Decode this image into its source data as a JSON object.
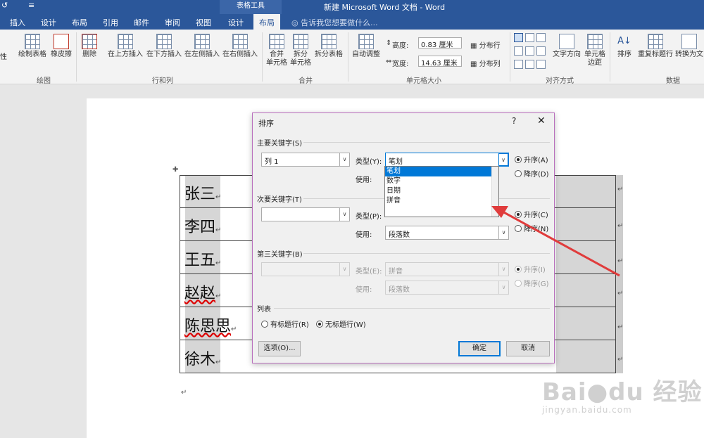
{
  "titlebar": {
    "quick_access": [
      "↺",
      "≡"
    ],
    "context_tab": "表格工具",
    "document_title": "新建 Microsoft Word 文档 - Word"
  },
  "tabs": {
    "insert": "插入",
    "design": "设计",
    "layout": "布局",
    "references": "引用",
    "mailings": "邮件",
    "review": "审阅",
    "view": "视图",
    "table_design": "设计",
    "table_layout": "布局",
    "tell_me": "告诉我您想要做什么..."
  },
  "ribbon": {
    "properties_partial": "性",
    "draw_table": "绘制表格",
    "eraser": "橡皮擦",
    "group_draw": "绘图",
    "delete": "删除",
    "insert_above": "在上方插入",
    "insert_below": "在下方插入",
    "insert_left": "在左侧插入",
    "insert_right": "在右侧插入",
    "group_rows_cols": "行和列",
    "merge_cells": "合并\n单元格",
    "merge_cells_l1": "合并",
    "merge_cells_l2": "单元格",
    "split_cells_l1": "拆分",
    "split_cells_l2": "单元格",
    "split_table": "拆分表格",
    "group_merge": "合并",
    "autofit": "自动调整",
    "height_label": "高度:",
    "height_value": "0.83 厘米",
    "width_label": "宽度:",
    "width_value": "14.63 厘米",
    "distribute_rows": "分布行",
    "distribute_cols": "分布列",
    "group_cell_size": "单元格大小",
    "text_direction": "文字方向",
    "cell_margins_l1": "单元格",
    "cell_margins_l2": "边距",
    "group_alignment": "对齐方式",
    "sort": "排序",
    "repeat_header": "重复标题行",
    "convert_text": "转换为文",
    "group_data": "数据"
  },
  "table_rows": [
    "张三",
    "李四",
    "王五",
    "赵赵",
    "陈思思",
    "徐木"
  ],
  "paragraph_mark": "↵",
  "dialog": {
    "title": "排序",
    "help": "?",
    "close": "✕",
    "primary_key": "主要关键字(S)",
    "primary_key_value": "列 1",
    "type_label": "类型(Y):",
    "type_value": "笔划",
    "using_label": "使用:",
    "asc_1": "升序(A)",
    "desc_1": "降序(D)",
    "secondary_key": "次要关键字(T)",
    "type_label_2": "类型(P):",
    "using_label_2": "使用:",
    "using_value_2": "段落数",
    "asc_2": "升序(C)",
    "desc_2": "降序(N)",
    "third_key": "第三关键字(B)",
    "type_label_3": "类型(E):",
    "type_value_3": "拼音",
    "using_label_3": "使用:",
    "using_value_3": "段落数",
    "asc_3": "升序(I)",
    "desc_3": "降序(G)",
    "list_label": "列表",
    "has_header": "有标题行(R)",
    "no_header": "无标题行(W)",
    "options": "选项(O)...",
    "ok": "确定",
    "cancel": "取消"
  },
  "dropdown_options": [
    "笔划",
    "数字",
    "日期",
    "拼音"
  ],
  "watermark": {
    "logo": "Bai●du 经验",
    "url": "jingyan.baidu.com"
  },
  "colors": {
    "word_blue": "#2b579a",
    "selection": "#0078d7",
    "arrow": "#e03c3c"
  }
}
